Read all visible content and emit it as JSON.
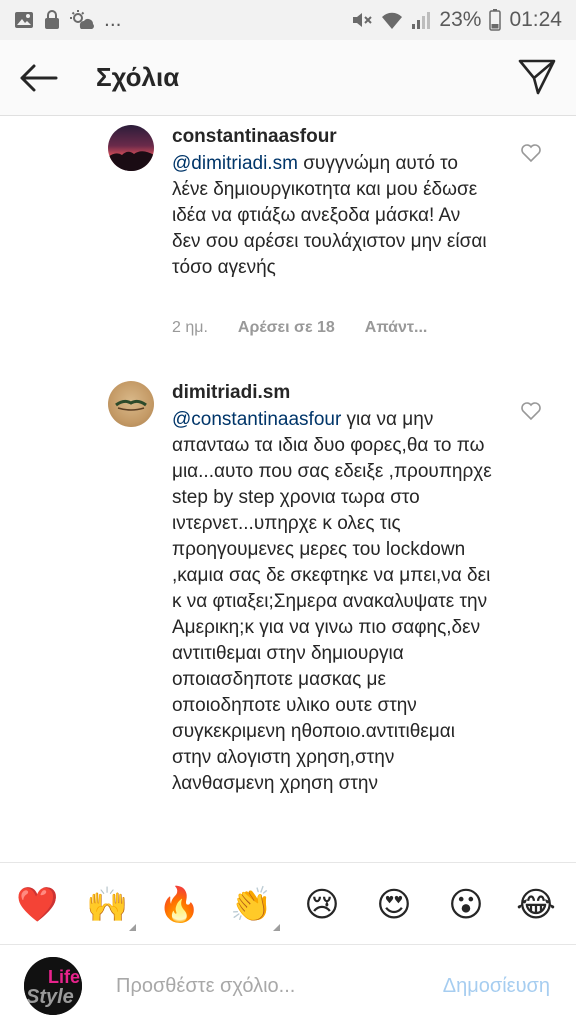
{
  "status_bar": {
    "more": "...",
    "battery_percent": "23%",
    "time": "01:24"
  },
  "header": {
    "title": "Σχόλια"
  },
  "comments": [
    {
      "username": "constantinaasfour",
      "mention": "@dimitriadi.sm",
      "text": " συγγνώμη αυτό το λένε δημιουργικοτητα και μου έδωσε ιδέα να φτιάξω ανεξοδα μάσκα! Αν δεν σου αρέσει τουλάχιστον μην είσαι τόσο αγενής",
      "time": "2 ημ.",
      "likes": "Αρέσει σε 18",
      "reply": "Απάντ..."
    },
    {
      "username": "dimitriadi.sm",
      "mention": "@constantinaasfour",
      "text": " για να μην απανταω τα ιδια δυο φορες,θα το πω μια...αυτο που σας εδειξε ,προυπηρχε step by step χρονια τωρα στο ιντερνετ...υπηρχε κ ολες τις προηγουμενες μερες του lockdown ,καμια σας δε σκεφτηκε να μπει,να δει κ να φτιαξει;Σημερα ανακαλυψατε την Αμερικη;κ για να γινω πιο σαφης,δεν αντιτιθεμαι στην δημιουργια οποιασδηποτε μασκας με οποιοδηποτε υλικο ουτε στην συγκεκριμενη ηθοποιο.αντιτιθεμαι στην αλογιστη χρηση,στην λανθασμενη χρηση στην"
    }
  ],
  "emoji_bar": [
    {
      "icon": "red-heart",
      "glyph": "❤️"
    },
    {
      "icon": "raising-hands-person",
      "glyph": "🙌"
    },
    {
      "icon": "fire",
      "glyph": "🔥"
    },
    {
      "icon": "clapping-hands",
      "glyph": "👏"
    },
    {
      "icon": "crying-face",
      "glyph": "😢"
    },
    {
      "icon": "heart-eyes-face",
      "glyph": "😍"
    },
    {
      "icon": "surprised-face",
      "glyph": "😮"
    },
    {
      "icon": "tears-of-joy-face",
      "glyph": "😂"
    }
  ],
  "composer": {
    "placeholder": "Προσθέστε σχόλιο...",
    "post_label": "Δημοσίευση",
    "avatar_logo_text": "Life Style"
  },
  "colors": {
    "mention": "#003569",
    "meta": "#999999",
    "post_disabled": "#a6cdf0"
  }
}
